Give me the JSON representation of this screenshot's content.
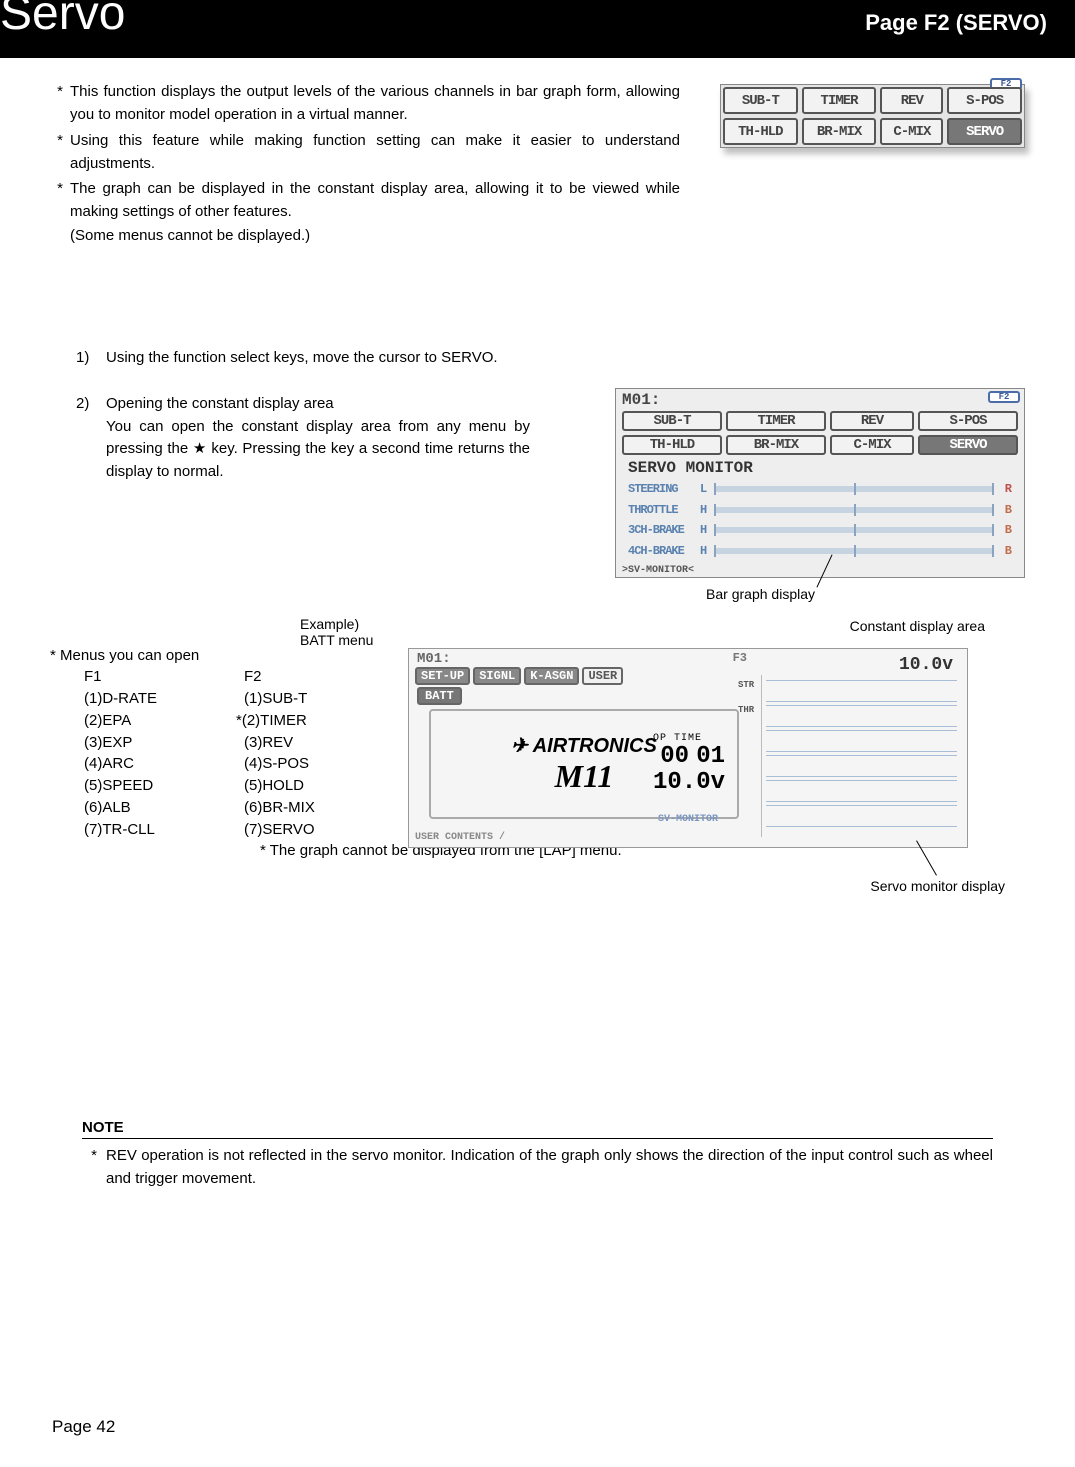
{
  "banner": {
    "title": "Servo",
    "right": "Page F2 (SERVO)"
  },
  "intro": {
    "b1": "This function displays the output levels of the various channels in bar graph form, allowing you to monitor model operation in a virtual manner.",
    "b2": "Using this feature while making function setting can make it easier to understand adjustments.",
    "b3": "The graph can be displayed in the constant display area, allowing it to be viewed while making settings of other features.",
    "b3s": "(Some menus cannot be displayed.)"
  },
  "chip": {
    "fz": "F2",
    "r1": {
      "c1": "SUB-T",
      "c2": "TIMER",
      "c3": "REV",
      "c4": "S-POS"
    },
    "r2": {
      "c1": "TH-HLD",
      "c2": "BR-MIX",
      "c3": "C-MIX",
      "c4": "SERVO"
    }
  },
  "steps": {
    "s1n": "1)",
    "s1": "Using the function select keys, move the cursor to SERVO.",
    "s2n": "2)",
    "s2t": "Opening the constant display area",
    "s2b": "You can open the constant display area from any menu by pressing the ★ key. Pressing the key a second time returns the display to normal."
  },
  "big": {
    "m": "M01:",
    "fz": "F2",
    "r1": {
      "c1": "SUB-T",
      "c2": "TIMER",
      "c3": "REV",
      "c4": "S-POS"
    },
    "r2": {
      "c1": "TH-HLD",
      "c2": "BR-MIX",
      "c3": "C-MIX",
      "c4": "SERVO"
    },
    "sec": "SERVO MONITOR",
    "bar1l": "STEERING",
    "bar1r": "R",
    "bar2l": "THROTTLE",
    "bar2r": "B",
    "bar3l": "3CH-BRAKE",
    "bar3r": "B",
    "bar4l": "4CH-BRAKE",
    "bar4r": "B",
    "foot": ">SV-MONITOR<",
    "cap_bar": "Bar graph display",
    "cap_const": "Constant display area"
  },
  "example": {
    "label": "Example)",
    "sub": "BATT menu",
    "m": "M01:",
    "fz": "F3",
    "volt": "10.0v",
    "tabs": {
      "t1": "SET-UP",
      "t2": "SIGNL",
      "t3": "K-ASGN",
      "t4": "USER"
    },
    "batt": "BATT",
    "logo": "AIRTRONICS",
    "m11": "M11",
    "time_label": "OP TIME",
    "time_top": "00 01",
    "time_bot": "10.0v",
    "footer": "USER CONTENTS / ",
    "mid": "SV-MONITOR",
    "rlab1": "STR",
    "rlab2": "THR",
    "cap": "Servo monitor display"
  },
  "menus": {
    "hdr": "*  Menus you can open",
    "h1": "F1",
    "h2": "F2",
    "c1": [
      "(1)D-RATE",
      "(2)EPA",
      "(3)EXP",
      "(4)ARC",
      "(5)SPEED",
      "(6)ALB",
      "(7)TR-CLL"
    ],
    "c2": [
      "(1)SUB-T",
      "*(2)TIMER",
      "(3)REV",
      "(4)S-POS",
      "(5)HOLD",
      "(6)BR-MIX",
      "(7)SERVO"
    ],
    "note": "* The graph cannot be displayed from the [LAP] menu."
  },
  "note": {
    "hdr": "NOTE",
    "body": "REV operation is not reflected in the servo monitor. Indication of the graph only shows the direction of the input control such as wheel and trigger movement."
  },
  "pagenum": "Page 42"
}
